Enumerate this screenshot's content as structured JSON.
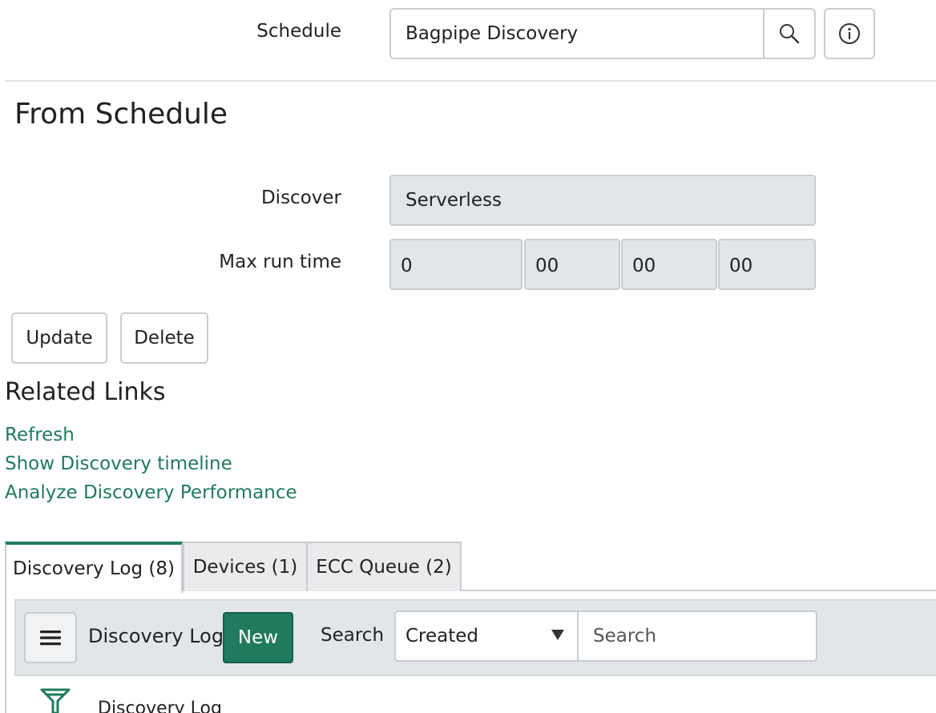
{
  "schedule": {
    "label": "Schedule",
    "value": "Bagpipe Discovery",
    "lookup_icon": "search-icon",
    "info_icon": "info-icon"
  },
  "section": {
    "title": "From Schedule"
  },
  "discover": {
    "label": "Discover",
    "value": "Serverless"
  },
  "max_run_time": {
    "label": "Max run time",
    "values": [
      "0",
      "00",
      "00",
      "00"
    ]
  },
  "actions": {
    "update": "Update",
    "delete": "Delete"
  },
  "related_links": {
    "title": "Related Links",
    "items": [
      "Refresh",
      "Show Discovery timeline",
      "Analyze Discovery Performance"
    ]
  },
  "tabs": [
    {
      "label": "Discovery Log (8)",
      "active": true
    },
    {
      "label": "Devices (1)",
      "active": false
    },
    {
      "label": "ECC Queue (2)",
      "active": false
    }
  ],
  "list": {
    "menu_icon": "hamburger-icon",
    "title": "Discovery Log",
    "new_label": "New",
    "search_label": "Search",
    "search_field": "Created",
    "search_placeholder": "Search",
    "filter_icon": "funnel-icon",
    "breadcrumb": "Discovery Log"
  },
  "colors": {
    "accent": "#1f7a5e",
    "readonly_bg": "#e3e6e9",
    "border": "#c9ccd0"
  }
}
